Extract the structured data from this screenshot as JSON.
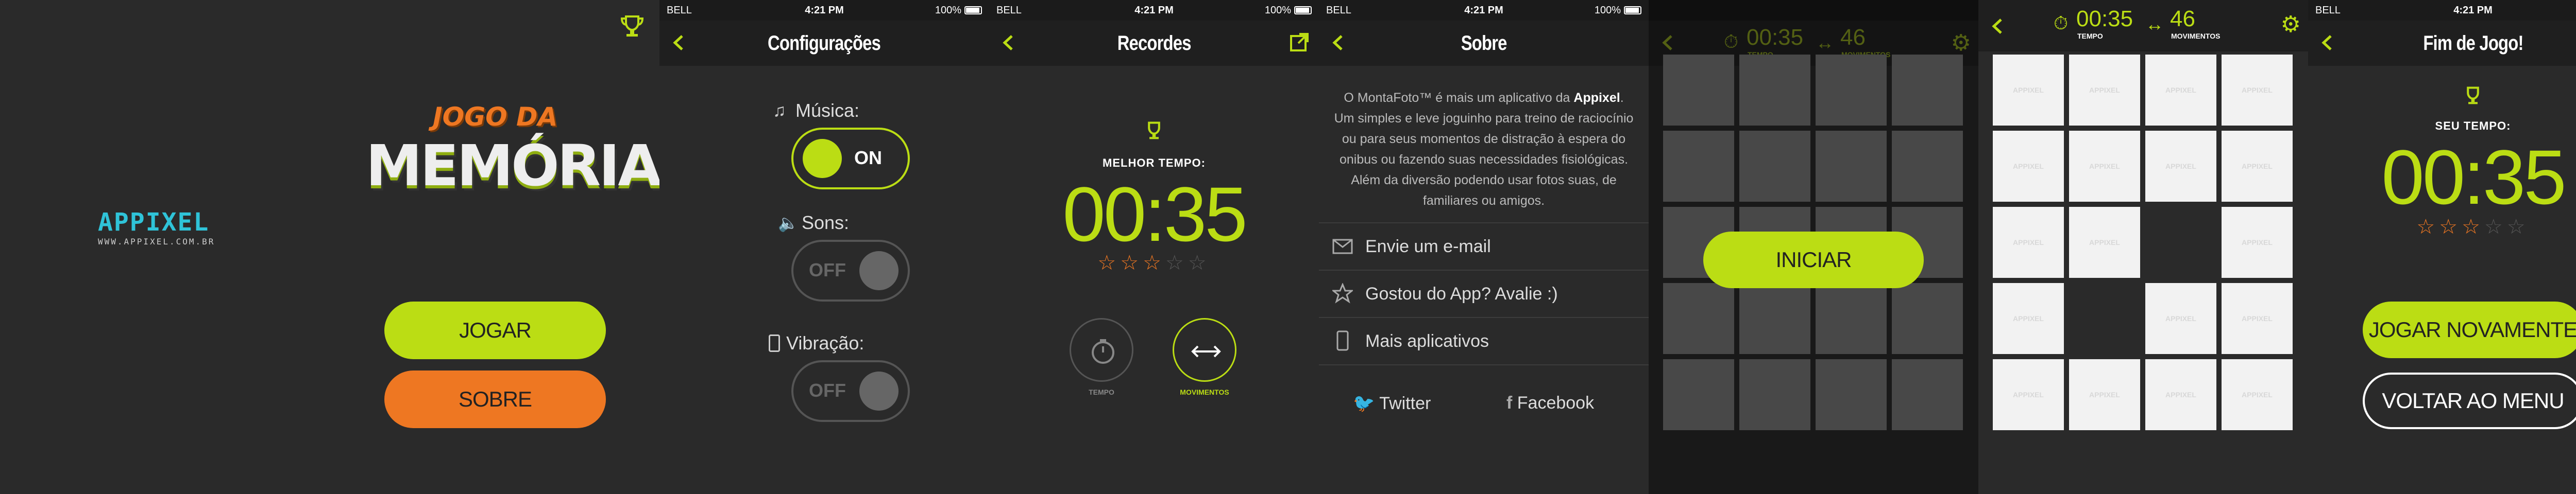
{
  "status": {
    "carrier": "BELL",
    "time": "4:21 PM",
    "battery": "100%"
  },
  "home": {
    "logo_text": "APPIXEL",
    "logo_url": "WWW.APPIXEL.COM.BR",
    "title_top": "JOGO DA",
    "title_bottom": "MEMÓRIA",
    "play_label": "JOGAR",
    "about_label": "SOBRE"
  },
  "settings": {
    "title": "Configurações",
    "music_label": "Música:",
    "music_state": "ON",
    "sounds_label": "Sons:",
    "sounds_state": "OFF",
    "vibration_label": "Vibração:",
    "vibration_state": "OFF"
  },
  "records": {
    "title": "Recordes",
    "best_label": "MELHOR TEMPO:",
    "best_time": "00:35",
    "rating": 2.5,
    "tab_time": "TEMPO",
    "tab_moves": "MOVIMENTOS"
  },
  "about": {
    "title": "Sobre",
    "desc_pre": "O MontaFoto™ é mais um aplicativo da ",
    "desc_brand": "Appixel",
    "desc_post": ".\nUm simples e leve joguinho para treino de raciocínio ou para seus momentos de distração à espera do onibus ou fazendo suas necessidades fisiológicas. Além da diversão podendo usar fotos suas, de familiares ou amigos.",
    "email": "Envie um e-mail",
    "rate": "Gostou do App? Avalie :)",
    "more": "Mais aplicativos",
    "twitter": "Twitter",
    "facebook": "Facebook"
  },
  "game": {
    "time": "00:35",
    "time_label": "TEMPO",
    "moves": "46",
    "moves_label": "MOVIMENTOS",
    "start_label": "INICIAR",
    "card_text": "APPIXEL"
  },
  "gameover": {
    "title": "Fim de Jogo!",
    "your_time_label": "SEU TEMPO:",
    "time": "00:35",
    "rating": 2.5,
    "again_label": "JOGAR NOVAMENTE",
    "back_label": "VOLTAR AO MENU"
  },
  "colors": {
    "accent": "#bbdd14",
    "orange": "#ee7722",
    "bg": "#2a2a2a"
  }
}
